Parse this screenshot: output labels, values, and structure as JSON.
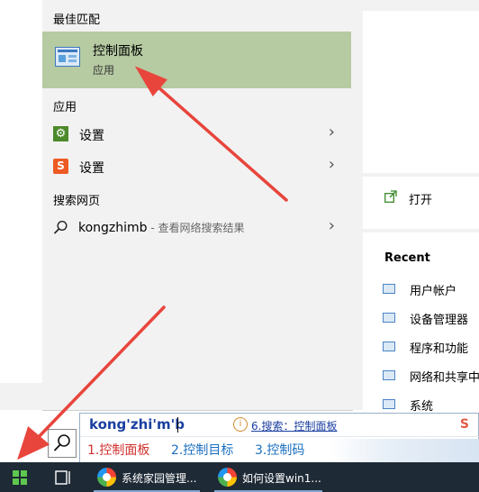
{
  "results": {
    "best_match_title": "最佳匹配",
    "best_match": {
      "name": "控制面板",
      "type": "应用",
      "icon": "control-panel-icon"
    },
    "apps_title": "应用",
    "apps": [
      {
        "label": "设置",
        "icon": "gear-icon",
        "chevron": "›"
      },
      {
        "label": "设置",
        "icon": "sogou-s-icon",
        "chevron": "›"
      }
    ],
    "web_title": "搜索网页",
    "web": {
      "query": "kongzhimb",
      "suffix": " - 查看网络搜索结果",
      "icon": "search-icon",
      "chevron": "›"
    }
  },
  "preview": {
    "open_label": "打开",
    "recent_title": "Recent",
    "recent_items": [
      "用户帐户",
      "设备管理器",
      "程序和功能",
      "网络和共享中心",
      "系统"
    ]
  },
  "ime": {
    "composition": "kong'zhi'm'b",
    "hint_icon": "i",
    "hint": "6.搜索：控制面板",
    "candidates": [
      "1.控制面板",
      "2.控制目标",
      "3.控制码"
    ],
    "skin_mark": "S"
  },
  "taskbar": {
    "apps": [
      {
        "label": "系统家园管理...",
        "icon": "browser-orb-icon"
      },
      {
        "label": "如何设置win1...",
        "icon": "browser-orb-icon"
      }
    ]
  },
  "colors": {
    "best_match_bg": "#b6cba2",
    "panel_bg": "#f2f2f2",
    "taskbar_bg": "#1e2a36",
    "arrow": "#e8453c",
    "candidate_selected": "#d0312d",
    "candidate": "#1a6fc0"
  }
}
